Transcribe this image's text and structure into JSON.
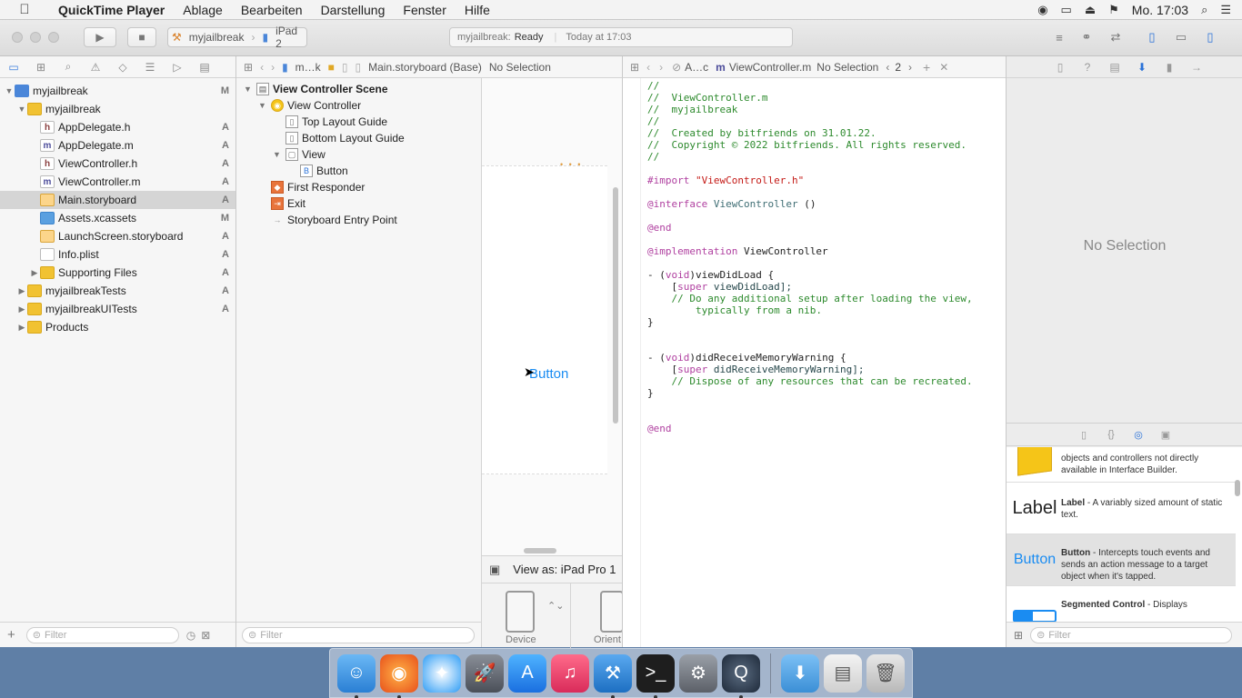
{
  "menubar": {
    "app_name": "QuickTime Player",
    "menus": [
      "Ablage",
      "Bearbeiten",
      "Darstellung",
      "Fenster",
      "Hilfe"
    ],
    "clock": "Mo. 17:03"
  },
  "toolbar": {
    "scheme_project": "myjailbreak",
    "scheme_device": "iPad 2",
    "activity_project": "myjailbreak:",
    "activity_status": "Ready",
    "activity_time": "Today at 17:03"
  },
  "navigator": {
    "items": [
      {
        "label": "myjailbreak",
        "badge": "M",
        "level": 0,
        "kind": "project",
        "disclosure": "open"
      },
      {
        "label": "myjailbreak",
        "badge": "",
        "level": 1,
        "kind": "folder",
        "disclosure": "open"
      },
      {
        "label": "AppDelegate.h",
        "badge": "A",
        "level": 2,
        "kind": "h"
      },
      {
        "label": "AppDelegate.m",
        "badge": "A",
        "level": 2,
        "kind": "m"
      },
      {
        "label": "ViewController.h",
        "badge": "A",
        "level": 2,
        "kind": "h"
      },
      {
        "label": "ViewController.m",
        "badge": "A",
        "level": 2,
        "kind": "m"
      },
      {
        "label": "Main.storyboard",
        "badge": "A",
        "level": 2,
        "kind": "storyboard",
        "selected": true
      },
      {
        "label": "Assets.xcassets",
        "badge": "M",
        "level": 2,
        "kind": "assets"
      },
      {
        "label": "LaunchScreen.storyboard",
        "badge": "A",
        "level": 2,
        "kind": "storyboard"
      },
      {
        "label": "Info.plist",
        "badge": "A",
        "level": 2,
        "kind": "plist"
      },
      {
        "label": "Supporting Files",
        "badge": "A",
        "level": 2,
        "kind": "folder",
        "disclosure": "closed"
      },
      {
        "label": "myjailbreakTests",
        "badge": "A",
        "level": 1,
        "kind": "folder",
        "disclosure": "closed"
      },
      {
        "label": "myjailbreakUITests",
        "badge": "A",
        "level": 1,
        "kind": "folder",
        "disclosure": "closed"
      },
      {
        "label": "Products",
        "badge": "",
        "level": 1,
        "kind": "folder",
        "disclosure": "closed"
      }
    ],
    "filter_placeholder": "Filter"
  },
  "storyboard": {
    "jump_bar": [
      "m…k",
      "Main.storyboard (Base)",
      "No Selection"
    ],
    "outline": [
      {
        "label": "View Controller Scene",
        "level": 0,
        "bold": true
      },
      {
        "label": "View Controller",
        "level": 1
      },
      {
        "label": "Top Layout Guide",
        "level": 2
      },
      {
        "label": "Bottom Layout Guide",
        "level": 2
      },
      {
        "label": "View",
        "level": 2
      },
      {
        "label": "Button",
        "level": 3
      },
      {
        "label": "First Responder",
        "level": 1
      },
      {
        "label": "Exit",
        "level": 1
      },
      {
        "label": "Storyboard Entry Point",
        "level": 1
      }
    ],
    "outline_filter_placeholder": "Filter",
    "canvas_button_title": "Button",
    "view_as": "View as: iPad Pro 1",
    "device_label": "Device",
    "orientation_label": "Orient"
  },
  "editor": {
    "jump_bar": [
      "A…c",
      "ViewController.m",
      "No Selection"
    ],
    "counterpart_count": "2",
    "code_lines": [
      {
        "t": "//",
        "c": "cm"
      },
      {
        "t": "//  ViewController.m",
        "c": "cm"
      },
      {
        "t": "//  myjailbreak",
        "c": "cm"
      },
      {
        "t": "//",
        "c": "cm"
      },
      {
        "t": "//  Created by bitfriends on 31.01.22.",
        "c": "cm"
      },
      {
        "t": "//  Copyright © 2022 bitfriends. All rights reserved.",
        "c": "cm"
      },
      {
        "t": "//",
        "c": "cm"
      },
      {
        "t": "",
        "c": ""
      },
      {
        "t": "#import \"ViewController.h\"",
        "c": "import"
      },
      {
        "t": "",
        "c": ""
      },
      {
        "t": "@interface ViewController ()",
        "c": "interface"
      },
      {
        "t": "",
        "c": ""
      },
      {
        "t": "@end",
        "c": "kw"
      },
      {
        "t": "",
        "c": ""
      },
      {
        "t": "@implementation ViewController",
        "c": "impl"
      },
      {
        "t": "",
        "c": ""
      },
      {
        "t": "- (void)viewDidLoad {",
        "c": "method"
      },
      {
        "t": "    [super viewDidLoad];",
        "c": "super"
      },
      {
        "t": "    // Do any additional setup after loading the view,",
        "c": "cm"
      },
      {
        "t": "        typically from a nib.",
        "c": "cm"
      },
      {
        "t": "}",
        "c": ""
      },
      {
        "t": "",
        "c": ""
      },
      {
        "t": "",
        "c": ""
      },
      {
        "t": "- (void)didReceiveMemoryWarning {",
        "c": "method"
      },
      {
        "t": "    [super didReceiveMemoryWarning];",
        "c": "super"
      },
      {
        "t": "    // Dispose of any resources that can be recreated.",
        "c": "cm"
      },
      {
        "t": "}",
        "c": ""
      },
      {
        "t": "",
        "c": ""
      },
      {
        "t": "",
        "c": ""
      },
      {
        "t": "@end",
        "c": "kw"
      }
    ]
  },
  "inspector": {
    "no_selection": "No Selection",
    "library": [
      {
        "thumb": "",
        "title": "",
        "text": "objects and controllers not directly available in Interface Builder."
      },
      {
        "thumb": "Label",
        "title": "Label",
        "text": " - A variably sized amount of static text."
      },
      {
        "thumb": "Button",
        "title": "Button",
        "text": " - Intercepts touch events and sends an action message to a target object when it's tapped."
      },
      {
        "thumb": "",
        "title": "Segmented Control",
        "text": " - Displays"
      }
    ],
    "filter_placeholder": "Filter"
  },
  "colors": {
    "accent": "#2a72d8",
    "button_blue": "#1a8cf2",
    "comment_green": "#2d8a2d",
    "keyword_purple": "#b040a0"
  },
  "dock": [
    "finder-icon",
    "firefox-icon",
    "safari-icon",
    "launchpad-icon",
    "app-store-icon",
    "itunes-icon",
    "xcode-icon",
    "terminal-icon",
    "system-preferences-icon",
    "quicktime-icon",
    "downloads-folder-icon",
    "preview-icon",
    "trash-icon"
  ]
}
